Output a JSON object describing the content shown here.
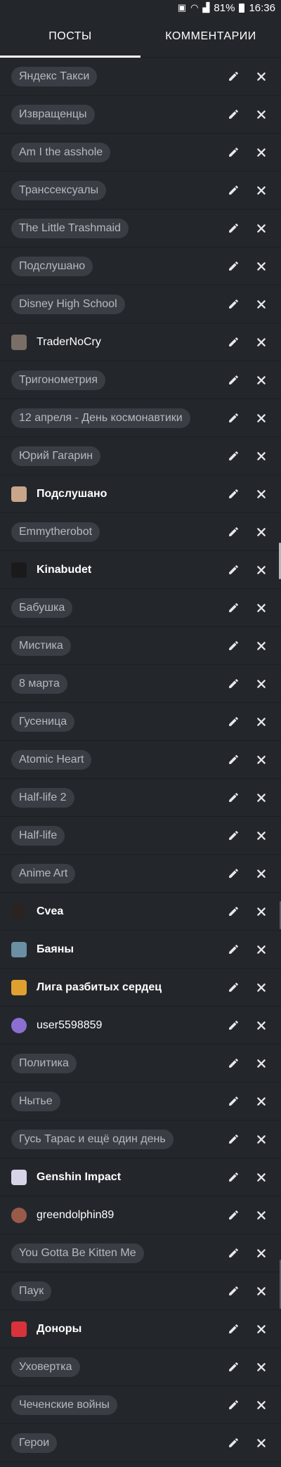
{
  "status": {
    "battery": "81%",
    "time": "16:36"
  },
  "tabs": [
    {
      "label": "ПОСТЫ"
    },
    {
      "label": "КОММЕНТАРИИ"
    }
  ],
  "rows": [
    {
      "kind": "tag",
      "label": "Яндекс Такси"
    },
    {
      "kind": "tag",
      "label": "Извращенцы"
    },
    {
      "kind": "tag",
      "label": "Am I the asshole"
    },
    {
      "kind": "tag",
      "label": "Транссексуалы"
    },
    {
      "kind": "tag",
      "label": "The Little Trashmaid"
    },
    {
      "kind": "tag",
      "label": "Подслушано"
    },
    {
      "kind": "tag",
      "label": "Disney High School"
    },
    {
      "kind": "user",
      "label": "TraderNoCry",
      "color": "#7a6f66"
    },
    {
      "kind": "tag",
      "label": "Тригонометрия"
    },
    {
      "kind": "tag",
      "label": "12 апреля - День космонавтики"
    },
    {
      "kind": "tag",
      "label": "Юрий Гагарин"
    },
    {
      "kind": "community",
      "label": "Подслушано",
      "color": "#c9a58a"
    },
    {
      "kind": "tag",
      "label": "Emmytherobot"
    },
    {
      "kind": "community",
      "label": "Kinabudet",
      "color": "#1a1a1a"
    },
    {
      "kind": "tag",
      "label": "Бабушка"
    },
    {
      "kind": "tag",
      "label": "Мистика"
    },
    {
      "kind": "tag",
      "label": "8 марта"
    },
    {
      "kind": "tag",
      "label": "Гусеница"
    },
    {
      "kind": "tag",
      "label": "Atomic Heart"
    },
    {
      "kind": "tag",
      "label": "Half-life 2"
    },
    {
      "kind": "tag",
      "label": "Half-life"
    },
    {
      "kind": "tag",
      "label": "Anime Art"
    },
    {
      "kind": "community",
      "label": "Cvea",
      "color": "#2a2320",
      "round": true
    },
    {
      "kind": "community",
      "label": "Баяны",
      "color": "#6b8fa3"
    },
    {
      "kind": "community",
      "label": "Лига разбитых сердец",
      "color": "#e0a030"
    },
    {
      "kind": "user",
      "label": "user5598859",
      "color": "#8a6fd1",
      "round": true
    },
    {
      "kind": "tag",
      "label": "Политика"
    },
    {
      "kind": "tag",
      "label": "Нытье"
    },
    {
      "kind": "tag",
      "label": "Гусь Тарас и ещё один день"
    },
    {
      "kind": "community",
      "label": "Genshin Impact",
      "color": "#d8d4e8"
    },
    {
      "kind": "user",
      "label": "greendolphin89",
      "color": "#9a5a4a",
      "round": true
    },
    {
      "kind": "tag",
      "label": "You Gotta Be Kitten Me"
    },
    {
      "kind": "tag",
      "label": "Паук"
    },
    {
      "kind": "community",
      "label": "Доноры",
      "color": "#d9323a"
    },
    {
      "kind": "tag",
      "label": "Уховертка"
    },
    {
      "kind": "tag",
      "label": "Чеченские войны"
    },
    {
      "kind": "tag",
      "label": "Герои"
    }
  ]
}
